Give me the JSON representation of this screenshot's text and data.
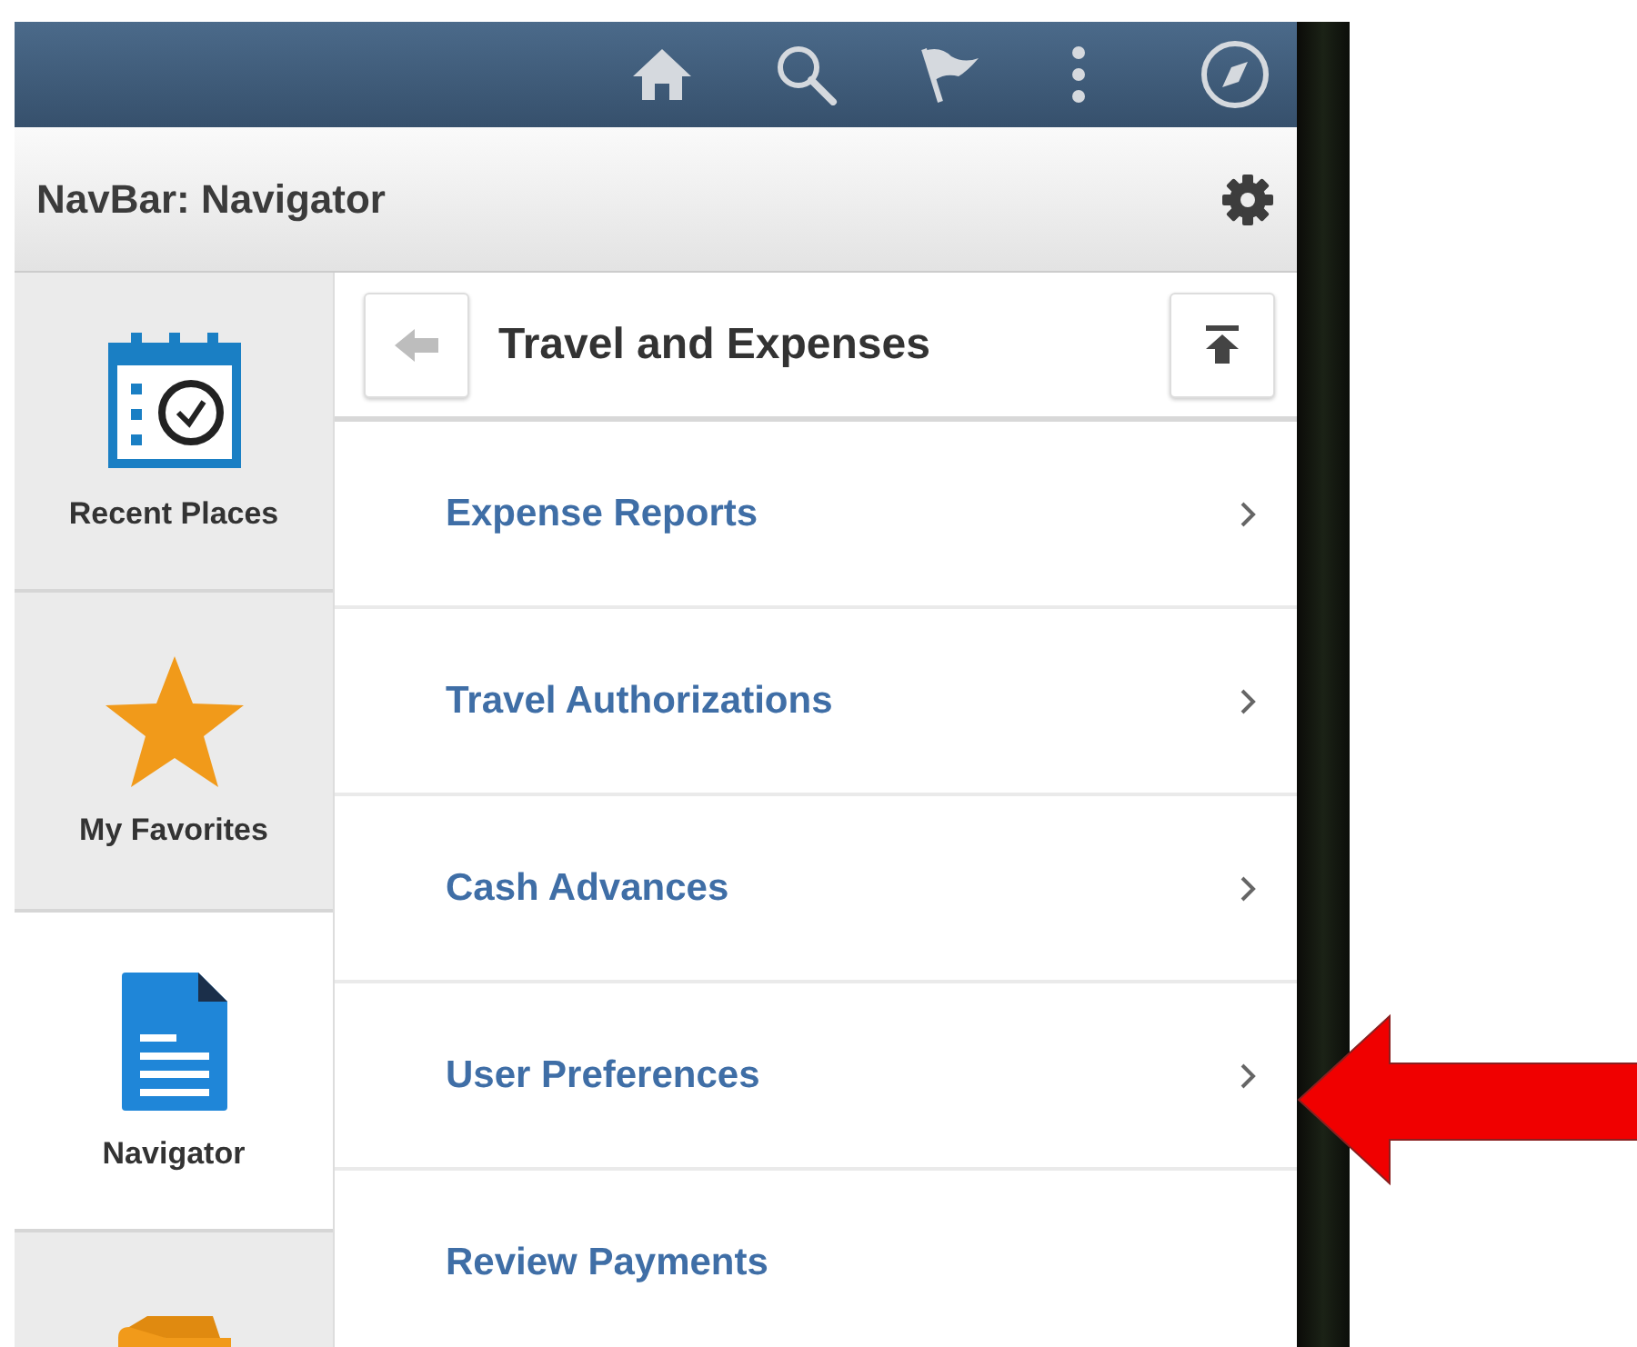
{
  "top_bar": {
    "icons": [
      {
        "kind": "home"
      },
      {
        "kind": "search"
      },
      {
        "kind": "flag"
      },
      {
        "kind": "more"
      },
      {
        "kind": "compass"
      }
    ]
  },
  "header": {
    "title": "NavBar: Navigator"
  },
  "sidebar": {
    "items": [
      {
        "label": "Recent Places",
        "kind": "recent",
        "selected": false
      },
      {
        "label": "My Favorites",
        "kind": "favorites",
        "selected": false
      },
      {
        "label": "Navigator",
        "kind": "navigator",
        "selected": true
      },
      {
        "kind": "folder",
        "selected": false
      }
    ]
  },
  "panel": {
    "title": "Travel and Expenses",
    "items": [
      {
        "label": "Expense Reports",
        "chevron": true
      },
      {
        "label": "Travel Authorizations",
        "chevron": true
      },
      {
        "label": "Cash Advances",
        "chevron": true
      },
      {
        "label": "User Preferences",
        "chevron": true
      },
      {
        "label": "Review Payments",
        "chevron": false
      }
    ]
  },
  "annotation": {
    "kind": "arrow"
  }
}
